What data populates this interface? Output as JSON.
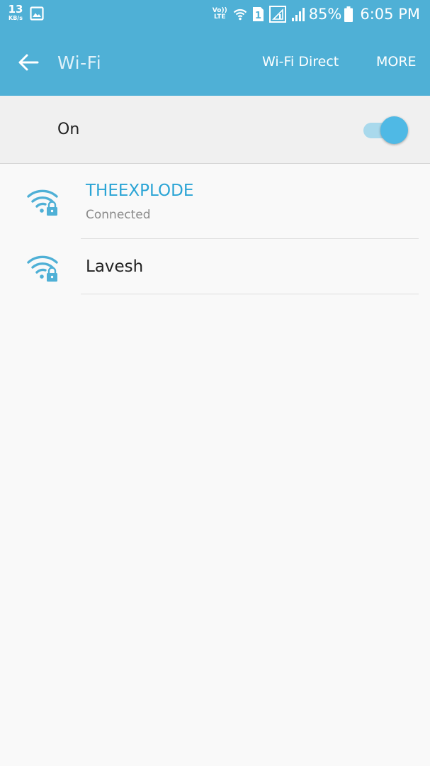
{
  "status_bar": {
    "net_speed_value": "13",
    "net_speed_unit": "KB/s",
    "volte_top": "Vo))",
    "volte_bottom": "LTE",
    "sim_number": "1",
    "battery_percent": "85%",
    "time": "6:05 PM"
  },
  "app_bar": {
    "title": "Wi-Fi",
    "wifi_direct_label": "Wi-Fi Direct",
    "more_label": "MORE"
  },
  "wifi_toggle": {
    "label": "On",
    "enabled": true
  },
  "networks": [
    {
      "name": "THEEXPLODE",
      "status": "Connected",
      "secured": true,
      "connected": true
    },
    {
      "name": "Lavesh",
      "status": "",
      "secured": true,
      "connected": false
    }
  ],
  "colors": {
    "accent": "#4fb0d6",
    "connected_text": "#2aa4d5",
    "toggle_knob": "#4fb9e5",
    "toggle_track": "#a9d9ec",
    "background": "#f9f9f9"
  },
  "icons": {
    "back": "arrow-left-icon",
    "network": "wifi-lock-icon",
    "gallery": "image-icon"
  }
}
